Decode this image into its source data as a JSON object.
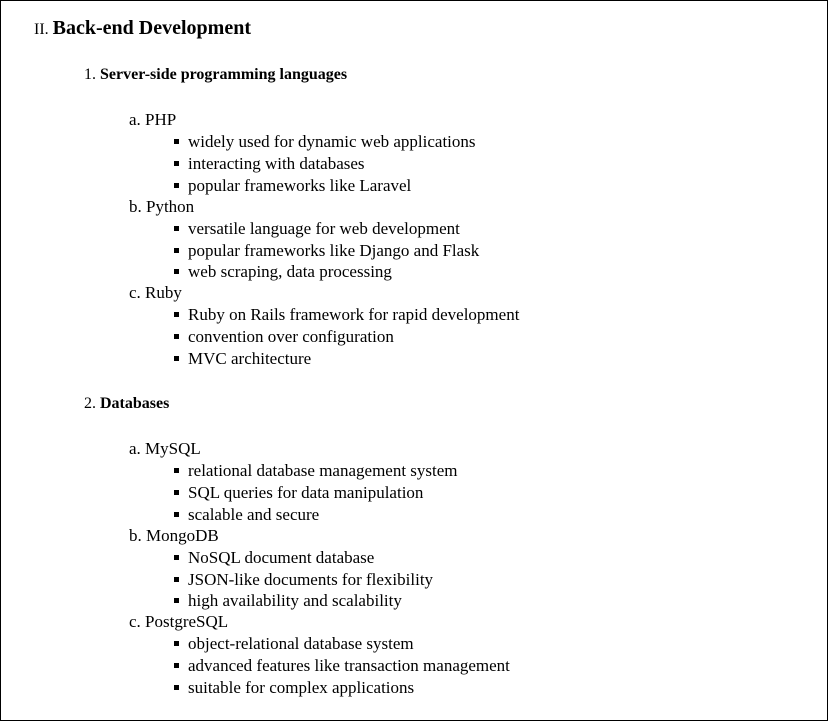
{
  "section": {
    "number": "II.",
    "title": "Back-end Development"
  },
  "groups": [
    {
      "number": "1.",
      "title": "Server-side programming languages",
      "items": [
        {
          "letter": "a.",
          "label": "PHP",
          "bullets": [
            "widely used for dynamic web applications",
            "interacting with databases",
            "popular frameworks like Laravel"
          ]
        },
        {
          "letter": "b.",
          "label": "Python",
          "bullets": [
            "versatile language for web development",
            "popular frameworks like Django and Flask",
            "web scraping, data processing"
          ]
        },
        {
          "letter": "c.",
          "label": "Ruby",
          "bullets": [
            "Ruby on Rails framework for rapid development",
            "convention over configuration",
            "MVC architecture"
          ]
        }
      ]
    },
    {
      "number": "2.",
      "title": "Databases",
      "items": [
        {
          "letter": "a.",
          "label": "MySQL",
          "bullets": [
            "relational database management system",
            "SQL queries for data manipulation",
            "scalable and secure"
          ]
        },
        {
          "letter": "b.",
          "label": "MongoDB",
          "bullets": [
            "NoSQL document database",
            "JSON-like documents for flexibility",
            "high availability and scalability"
          ]
        },
        {
          "letter": "c.",
          "label": "PostgreSQL",
          "bullets": [
            "object-relational database system",
            "advanced features like transaction management",
            "suitable for complex applications"
          ]
        }
      ]
    }
  ]
}
